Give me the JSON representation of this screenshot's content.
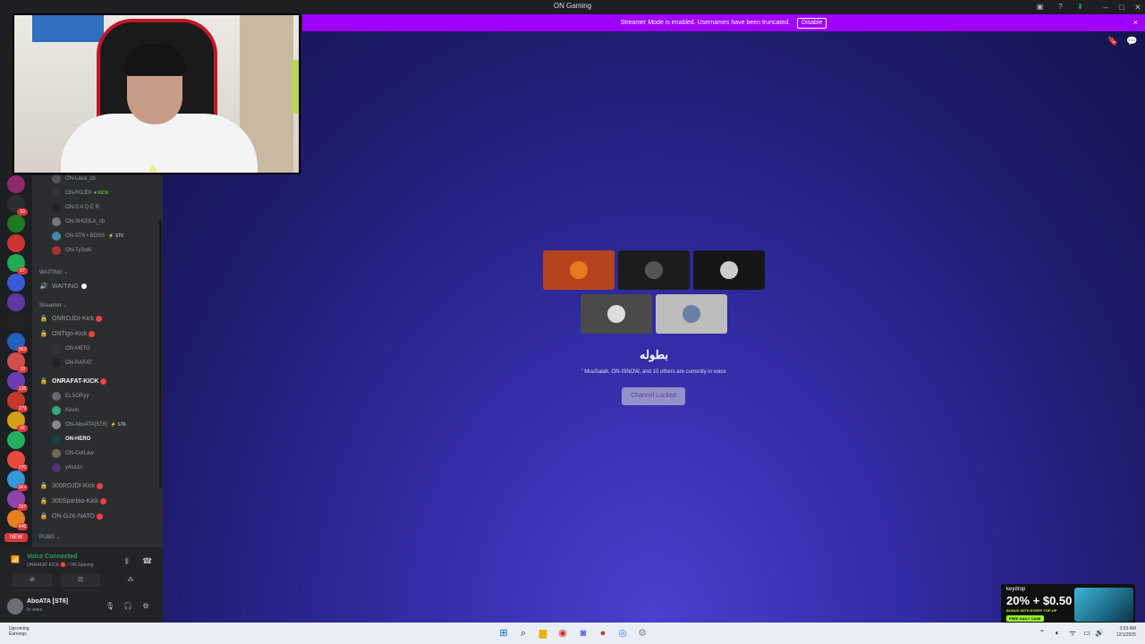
{
  "window": {
    "title": "ON Gaming"
  },
  "banner": {
    "text": "Streamer Mode is enabled. Usernames have been truncated.",
    "disable_label": "Disable",
    "close_label": "×"
  },
  "server_rail": {
    "servers": [
      {
        "color": "#8e2a6b",
        "badge": ""
      },
      {
        "color": "#2b2d31",
        "badge": "10"
      },
      {
        "color": "#1f7a1f",
        "badge": ""
      },
      {
        "color": "#cc3333",
        "badge": ""
      },
      {
        "color": "#22aa55",
        "badge": "67"
      },
      {
        "color": "#3b5bd6",
        "badge": ""
      },
      {
        "color": "#5a3aa0",
        "badge": ""
      },
      {
        "color": "#222222",
        "badge": ""
      },
      {
        "color": "#2060c0",
        "badge": "363"
      },
      {
        "color": "#d05050",
        "badge": "33"
      },
      {
        "color": "#6a3fb5",
        "badge": "128"
      },
      {
        "color": "#c0392b",
        "badge": "279"
      },
      {
        "color": "#d4a017",
        "badge": "66"
      },
      {
        "color": "#27ae60",
        "badge": ""
      },
      {
        "color": "#e74c3c",
        "badge": "270"
      },
      {
        "color": "#3498db",
        "badge": "1K+"
      },
      {
        "color": "#8e44ad",
        "badge": "297"
      },
      {
        "color": "#e67e22",
        "badge": "646"
      }
    ],
    "new_label": "NEW"
  },
  "sidebar": {
    "top_users": [
      {
        "name": "ON-Lava_cb",
        "tag": "",
        "color": "#555"
      },
      {
        "name": "ON-ROJDI",
        "tag": "KICK",
        "color": "#333"
      },
      {
        "name": "ON-S A Q E R",
        "tag": "",
        "color": "#222"
      },
      {
        "name": "ON-SHO3LA_cb",
        "tag": "",
        "color": "#777"
      },
      {
        "name": "ON-ST6 • BOSS",
        "tag": "ST6",
        "color": "#48a"
      },
      {
        "name": "ON-TySoN",
        "tag": "",
        "color": "#a33"
      }
    ],
    "cat_waiting": "WAITING",
    "chan_waiting": "WAITING",
    "cat_streamer": "Streamer",
    "channels": [
      {
        "label": "ONROJDI-Kick"
      },
      {
        "label": "ONTigo-Kick"
      }
    ],
    "tigo_users": [
      {
        "name": "ON-M5TO",
        "color": "#333"
      },
      {
        "name": "ON-RAFAT",
        "color": "#222"
      }
    ],
    "active_channel": "ONRAFAT-KICK",
    "rafat_users": [
      {
        "name": "ELSORyy",
        "tag": "",
        "color": "#667"
      },
      {
        "name": "Kevin",
        "tag": "",
        "color": "#3a7"
      },
      {
        "name": "ON-AboATA[ST6]",
        "tag": "ST6",
        "color": "#888"
      },
      {
        "name": "ON-HERO",
        "tag": "",
        "color": "#144"
      },
      {
        "name": "ON-OutLaw",
        "tag": "",
        "color": "#765"
      },
      {
        "name": "y4sa1n",
        "tag": "",
        "color": "#537"
      }
    ],
    "more_channels": [
      {
        "label": "300ROJDI-Kick"
      },
      {
        "label": "300Spartaa-Kick"
      },
      {
        "label": "ON-G2K-NATO"
      }
    ],
    "cat_pubg": "PUBG"
  },
  "voice": {
    "status": "Voice Connected",
    "sub": "ONRAFAT-KICK 🔴 / ON Gaming"
  },
  "user_panel": {
    "name": "AboATA [ST6]",
    "status": "In voice"
  },
  "main": {
    "channel_title": "بطوله",
    "description": "' MuuSalah, ON-ISNOW, and 10 others are currently in voice",
    "locked_label": "Channel Locked",
    "tiles": [
      {
        "bg": "#b5431c",
        "av": "#e07b20"
      },
      {
        "bg": "#1c1c1c",
        "av": "#555555"
      },
      {
        "bg": "#161616",
        "av": "#cccccc"
      },
      {
        "bg": "#4a4a4a",
        "av": "#dddddd"
      },
      {
        "bg": "#bdbdbd",
        "av": "#6a7fa8"
      }
    ]
  },
  "webcam": {
    "overlay": "⟁"
  },
  "ad": {
    "brand": "keydrop",
    "big": "20% + $0.50",
    "small": "BONUS WITH EVERY TOP-UP",
    "pill": "FREE DAILY CASE"
  },
  "taskbar": {
    "weather_1": "Upcoming",
    "weather_2": "Earnings",
    "time": "3:53 AM",
    "date": "12/1/2025"
  }
}
